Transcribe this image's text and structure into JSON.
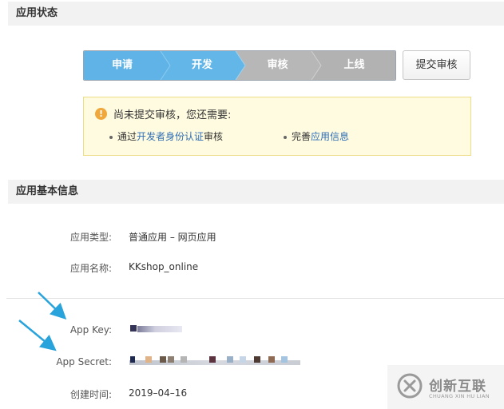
{
  "status_section": {
    "title": "应用状态",
    "steps": [
      "申请",
      "开发",
      "审核",
      "上线"
    ],
    "submit_button": "提交审核",
    "notice": {
      "title": "尚未提交审核，您还需要:",
      "req1": {
        "prefix": "通过",
        "link": "开发者身份认证",
        "suffix": "审核"
      },
      "req2": {
        "prefix": "完善",
        "link": "应用信息"
      }
    }
  },
  "basic_section": {
    "title": "应用基本信息",
    "app_type_label": "应用类型:",
    "app_type_value": "普通应用  –  网页应用",
    "app_name_label": "应用名称:",
    "app_name_value": "KKshop_online",
    "app_key_label": "App Key:",
    "app_secret_label": "App Secret:",
    "created_label": "创建时间:",
    "created_value": "2019–04–16"
  },
  "watermark": {
    "cn": "创新互联",
    "en": "CHUANG XIN HU LIAN"
  },
  "colors": {
    "step_active": "#5fb3e6",
    "step_inactive": "#b5b5b5",
    "link": "#2e6eb6",
    "arrow": "#29a3db"
  }
}
